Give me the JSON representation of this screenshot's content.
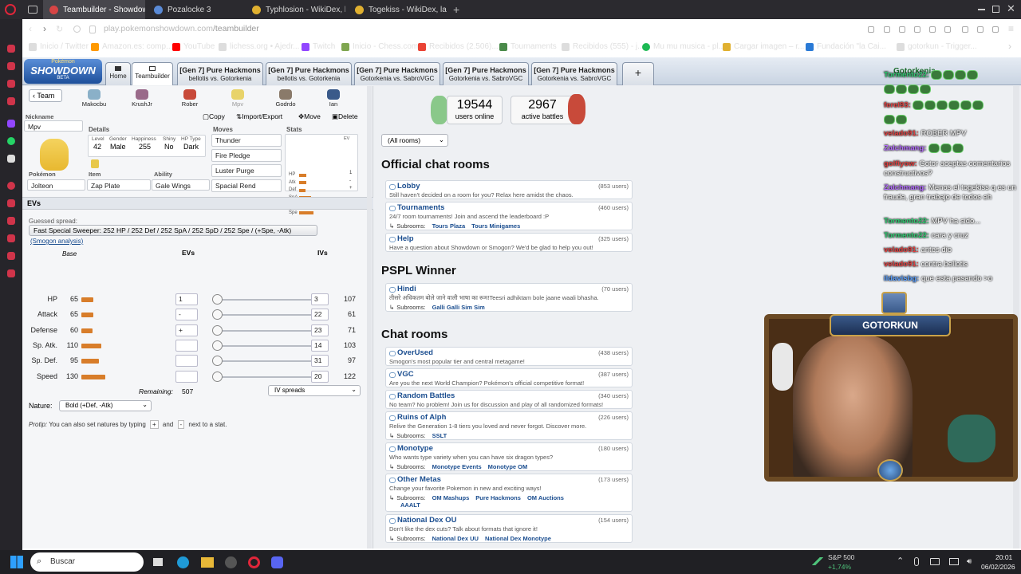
{
  "browser": {
    "tabs": [
      {
        "label": "Teambuilder - Showdown!",
        "active": true,
        "color": "#d64545"
      },
      {
        "label": "Pozalocke 3",
        "active": false,
        "color": "#5a8ad6"
      },
      {
        "label": "Typhlosion - WikiDex, la e",
        "active": false,
        "color": "#e0b030"
      },
      {
        "label": "Togekiss - WikiDex, la enc",
        "active": false,
        "color": "#e0b030"
      }
    ],
    "url_host": "play.pokemonshowdown.com",
    "url_path": "/teambuilder",
    "bookmarks": [
      "Inicio / Twitter",
      "Amazon.es: comp...",
      "YouTube",
      "lichess.org • Ajedr...",
      "Twitch",
      "Inicio - Chess.com",
      "Recibidos (2.506)...",
      "Tournaments",
      "Recibidos (555) - j...",
      "Mu mu musica - pl...",
      "Cargar imagen – r...",
      "Fundación \"la Cai...",
      "gotorkun - Trigger..."
    ]
  },
  "showdown": {
    "logo_top": "Pokémon",
    "logo_main": "SHOWDOWN",
    "logo_beta": "BETA",
    "home_label": "Home",
    "teambuilder_label": "Teambuilder",
    "battle_tabs": [
      {
        "title": "[Gen 7] Pure Hackmons",
        "players": "bellotis vs. Gotorkenia"
      },
      {
        "title": "[Gen 7] Pure Hackmons",
        "players": "bellotis vs. Gotorkenia"
      },
      {
        "title": "[Gen 7] Pure Hackmons",
        "players": "Gotorkenia vs. SabroVGC"
      },
      {
        "title": "[Gen 7] Pure Hackmons",
        "players": "Gotorkenia vs. SabroVGC"
      },
      {
        "title": "[Gen 7] Pure Hackmons",
        "players": "Gotorkenia vs. SabroVGC"
      }
    ],
    "add_tab": "+",
    "username": "Gotorkenia"
  },
  "teambuilder": {
    "team_button": "Team",
    "team": [
      "Makocbu",
      "KrushJr",
      "Rober",
      "Mpv",
      "Godrdo",
      "Ian"
    ],
    "actions": {
      "copy": "Copy",
      "import": "Import/Export",
      "move": "Move",
      "delete": "Delete"
    },
    "nickname_label": "Nickname",
    "nickname": "Mpv",
    "details_label": "Details",
    "details": {
      "level_label": "Level",
      "level": "42",
      "gender_label": "Gender",
      "gender": "Male",
      "happiness_label": "Happiness",
      "happiness": "255",
      "shiny_label": "Shiny",
      "shiny": "No",
      "hptype_label": "HP Type",
      "hptype": "Dark"
    },
    "pokemon_label": "Pokémon",
    "pokemon": "Jolteon",
    "item_label": "Item",
    "item": "Zap Plate",
    "ability_label": "Ability",
    "ability": "Gale Wings",
    "moves_label": "Moves",
    "moves": [
      "Thunder",
      "Fire Pledge",
      "Luster Purge",
      "Spacial Rend"
    ],
    "stats_label": "Stats",
    "stats_ev_label": "EV",
    "stat_short": [
      "HP",
      "Atk",
      "Def",
      "SpA",
      "SpD",
      "Spe"
    ],
    "stat_ev_preview": [
      "1",
      "-",
      "+",
      "",
      "",
      ""
    ],
    "evs_title": "EVs",
    "guessed_label": "Guessed spread:",
    "guessed_spread": "Fast Special Sweeper: 252 HP / 252 Def / 252 SpA / 252 SpD / 252 Spe / (+Spe, -Atk)",
    "smogon_analysis": "(Smogon analysis)",
    "col_base": "Base",
    "col_evs": "EVs",
    "col_ivs": "IVs",
    "stats": [
      {
        "name": "HP",
        "base": "65",
        "base_val": 65,
        "ev": "1",
        "iv": "3",
        "total": "107"
      },
      {
        "name": "Attack",
        "base": "65",
        "base_val": 65,
        "ev": "-",
        "iv": "22",
        "total": "61"
      },
      {
        "name": "Defense",
        "base": "60",
        "base_val": 60,
        "ev": "+",
        "iv": "23",
        "total": "71"
      },
      {
        "name": "Sp. Atk.",
        "base": "110",
        "base_val": 110,
        "ev": "",
        "iv": "14",
        "total": "103"
      },
      {
        "name": "Sp. Def.",
        "base": "95",
        "base_val": 95,
        "ev": "",
        "iv": "31",
        "total": "97"
      },
      {
        "name": "Speed",
        "base": "130",
        "base_val": 130,
        "ev": "",
        "iv": "20",
        "total": "122"
      }
    ],
    "remaining_label": "Remaining:",
    "remaining": "507",
    "iv_spreads": "IV spreads",
    "nature_label": "Nature:",
    "nature": "Bold (+Def, -Atk)",
    "protip_prefix": "Protip:",
    "protip_a": "You can also set natures by typing",
    "protip_plus": "+",
    "protip_and": "and",
    "protip_minus": "-",
    "protip_b": "next to a stat."
  },
  "lobby": {
    "users_online": "19544",
    "users_online_label": "users online",
    "active_battles": "2967",
    "active_battles_label": "active battles",
    "filter": "(All rooms)",
    "official_title": "Official chat rooms",
    "pspl_title": "PSPL Winner",
    "chat_title": "Chat rooms",
    "subrooms_label": "Subrooms:",
    "official": [
      {
        "name": "Lobby",
        "users": "(853 users)",
        "desc": "Still haven't decided on a room for you? Relax here amidst the chaos.",
        "subrooms": []
      },
      {
        "name": "Tournaments",
        "users": "(460 users)",
        "desc": "24/7 room tournaments! Join and ascend the leaderboard :P",
        "subrooms": [
          "Tours Plaza",
          "Tours Minigames"
        ]
      },
      {
        "name": "Help",
        "users": "(325 users)",
        "desc": "Have a question about Showdown or Smogon? We'd be glad to help you out!",
        "subrooms": []
      }
    ],
    "pspl": [
      {
        "name": "Hindi",
        "users": "(70 users)",
        "desc": "तीसरे अधिकतम बोले जाने वाली भाषा का रूम!Teesri adhiktam bole jaane waali bhasha.",
        "subrooms": [
          "Galli Galli Sim Sim"
        ]
      }
    ],
    "rooms": [
      {
        "name": "OverUsed",
        "users": "(438 users)",
        "desc": "Smogon's most popular tier and central metagame!",
        "subrooms": []
      },
      {
        "name": "VGC",
        "users": "(387 users)",
        "desc": "Are you the next World Champion? Pokémon's official competitive format!",
        "subrooms": []
      },
      {
        "name": "Random Battles",
        "users": "(340 users)",
        "desc": "No team? No problem! Join us for discussion and play of all randomized formats!",
        "subrooms": []
      },
      {
        "name": "Ruins of Alph",
        "users": "(226 users)",
        "desc": "Relive the Generation 1-8 tiers you loved and never forgot. Discover more.",
        "subrooms": [
          "SSLT"
        ]
      },
      {
        "name": "Monotype",
        "users": "(180 users)",
        "desc": "Who wants type variety when you can have six dragon types?",
        "subrooms": [
          "Monotype Events",
          "Monotype OM"
        ]
      },
      {
        "name": "Other Metas",
        "users": "(173 users)",
        "desc": "Change your favorite Pokemon in new and exciting ways!",
        "subrooms": [
          "OM Mashups",
          "Pure Hackmons",
          "OM Auctions",
          "AAALT"
        ]
      },
      {
        "name": "National Dex OU",
        "users": "(154 users)",
        "desc": "Don't like the dex cuts? Talk about formats that ignore it!",
        "subrooms": [
          "National Dex UU",
          "National Dex Monotype"
        ]
      }
    ]
  },
  "stream_chat": [
    {
      "user": "Tormento22:",
      "color": "#2ecc71",
      "text": ""
    },
    {
      "user": "",
      "color": "#2ecc71",
      "text": ""
    },
    {
      "user": "ferel93:",
      "color": "#e04040",
      "text": ""
    },
    {
      "user": "",
      "color": "#e04040",
      "text": ""
    },
    {
      "user": "velado91:",
      "color": "#e04040",
      "text": "ROBER MPV"
    },
    {
      "user": "Zalchmang:",
      "color": "#b56cff",
      "text": ""
    },
    {
      "user": "golfiyow:",
      "color": "#e04040",
      "text": "Gotor aceptas comentarios constructivos?"
    },
    {
      "user": "Zalchmang:",
      "color": "#b56cff",
      "text": "Menos el togekiss q es un fraude, gran trabajo de todos eh"
    },
    {
      "user": "Tormento22:",
      "color": "#2ecc71",
      "text": "MPV ha sido..."
    },
    {
      "user": "Tormento22:",
      "color": "#2ecc71",
      "text": "cara y cruz"
    },
    {
      "user": "velado91:",
      "color": "#e04040",
      "text": "antes dio"
    },
    {
      "user": "velado91:",
      "color": "#e04040",
      "text": "contra bellotis"
    },
    {
      "user": "ildavisbg:",
      "color": "#5aa0ff",
      "text": "que esta pasando >o"
    }
  ],
  "webcam_banner": "GOTORKUN",
  "taskbar": {
    "search": "Buscar",
    "stock_name": "S&P 500",
    "stock_change": "+1,74%",
    "time": "20:01",
    "date": "06/02/2026"
  }
}
